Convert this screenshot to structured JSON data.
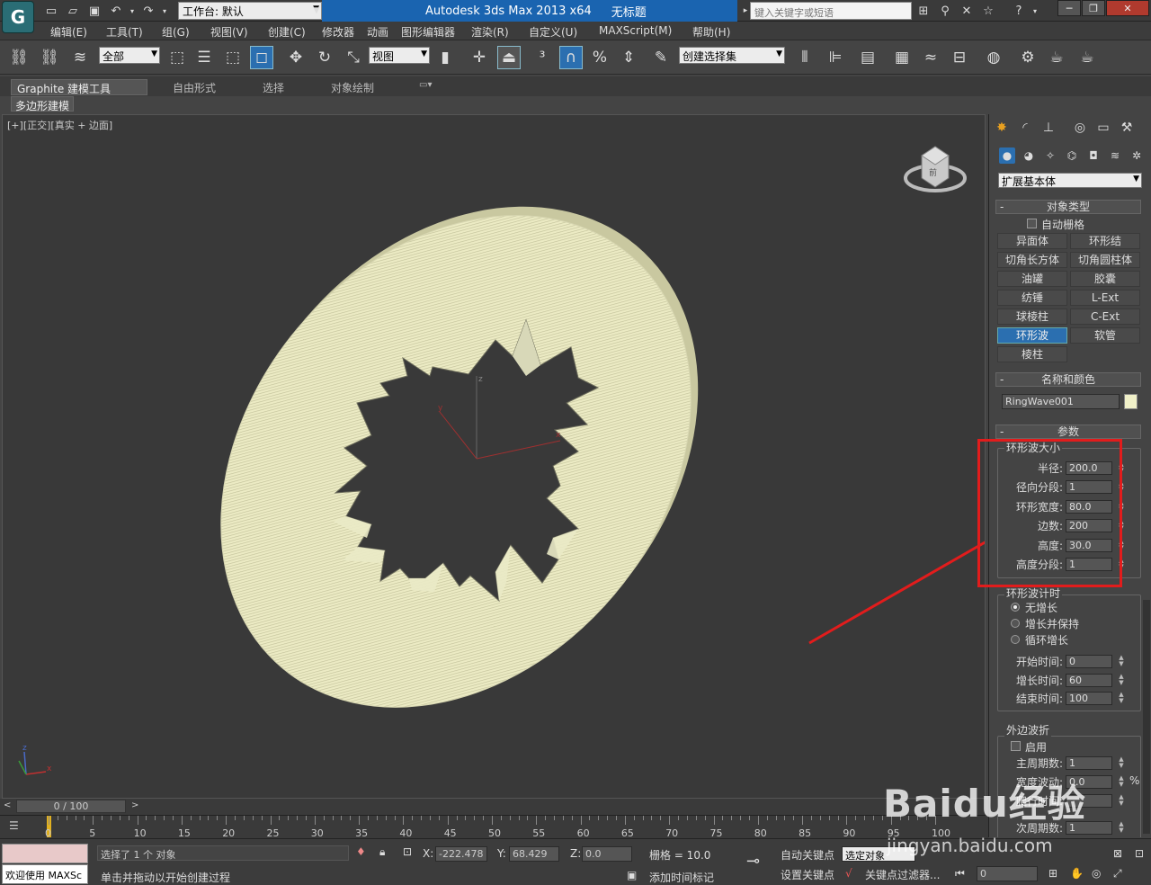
{
  "app": {
    "logo_letter": "G",
    "workspace_label": "工作台: 默认",
    "title_product": "Autodesk 3ds Max  2013 x64",
    "title_doc": "无标题",
    "search_placeholder": "键入关键字或短语"
  },
  "menu": [
    "编辑(E)",
    "工具(T)",
    "组(G)",
    "视图(V)",
    "创建(C)",
    "修改器",
    "动画",
    "图形编辑器",
    "渲染(R)",
    "自定义(U)",
    "MAXScript(M)",
    "帮助(H)"
  ],
  "toolbar": {
    "filter_select": "全部",
    "ref_coord_select": "视图",
    "named_selection": "创建选择集"
  },
  "ribbon": {
    "tabs": [
      "Graphite 建模工具",
      "自由形式",
      "选择",
      "对象绘制"
    ],
    "sub_tab": "多边形建模"
  },
  "viewport": {
    "label_plus": "[+]",
    "label_view": "[正交]",
    "label_shading": "[真实 + 边面]",
    "viewcube_face": "前"
  },
  "cmdpanel": {
    "category": "扩展基本体",
    "object_type": {
      "header": "对象类型",
      "autogrid": "自动栅格",
      "buttons": [
        "异面体",
        "环形结",
        "切角长方体",
        "切角圆柱体",
        "油罐",
        "胶囊",
        "纺锤",
        "L-Ext",
        "球棱柱",
        "C-Ext",
        "环形波",
        "软管",
        "棱柱"
      ],
      "active": "环形波"
    },
    "name_color": {
      "header": "名称和颜色",
      "name": "RingWave001",
      "color": "#f0f0c8"
    },
    "params": {
      "header": "参数",
      "size_group": "环形波大小",
      "size_fields": [
        {
          "label": "半径:",
          "value": "200.0"
        },
        {
          "label": "径向分段:",
          "value": "1"
        },
        {
          "label": "环形宽度:",
          "value": "80.0"
        },
        {
          "label": "边数:",
          "value": "200"
        },
        {
          "label": "高度:",
          "value": "30.0"
        },
        {
          "label": "高度分段:",
          "value": "1"
        }
      ],
      "timing_group": "环形波计时",
      "timing_options": [
        "无增长",
        "增长并保持",
        "循环增长"
      ],
      "timing_fields": [
        {
          "label": "开始时间:",
          "value": "0"
        },
        {
          "label": "增长时间:",
          "value": "60"
        },
        {
          "label": "结束时间:",
          "value": "100"
        }
      ],
      "outer_group": "外边波折",
      "outer_enable": "启用",
      "outer_fields": [
        {
          "label": "主周期数:",
          "value": "1"
        },
        {
          "label": "宽度波动:",
          "value": "0.0",
          "suffix": "%"
        },
        {
          "label": "爬行时间:",
          "value": ""
        },
        {
          "label": "次周期数:",
          "value": "1"
        }
      ]
    }
  },
  "timeline": {
    "slider": "0 / 100",
    "ticks": [
      "0",
      "5",
      "10",
      "15",
      "20",
      "25",
      "30",
      "35",
      "40",
      "45",
      "50",
      "55",
      "60",
      "65",
      "70",
      "75",
      "80",
      "85",
      "90",
      "95",
      "100"
    ]
  },
  "status": {
    "maxscript_label": "欢迎使用 MAXSc",
    "selected": "选择了 1 个 对象",
    "prompt": "单击并拖动以开始创建过程",
    "x_label": "X:",
    "x_value": "-222.478",
    "y_label": "Y:",
    "y_value": "68.429",
    "z_label": "Z:",
    "z_value": "0.0",
    "grid": "栅格 = 10.0",
    "add_time_tag": "添加时间标记",
    "auto_key": "自动关键点",
    "set_key": "设置关键点",
    "selected_obj": "选定对象",
    "key_filters": "关键点过滤器...",
    "frame": "0"
  },
  "watermark": {
    "main": "Baidu经验",
    "sub": "jingyan.baidu.com"
  },
  "colors": {
    "accent": "#2b6fb0",
    "highlight_box": "#e21c1c",
    "arrow": "#e21c1c",
    "object": "#f0f0c8"
  }
}
